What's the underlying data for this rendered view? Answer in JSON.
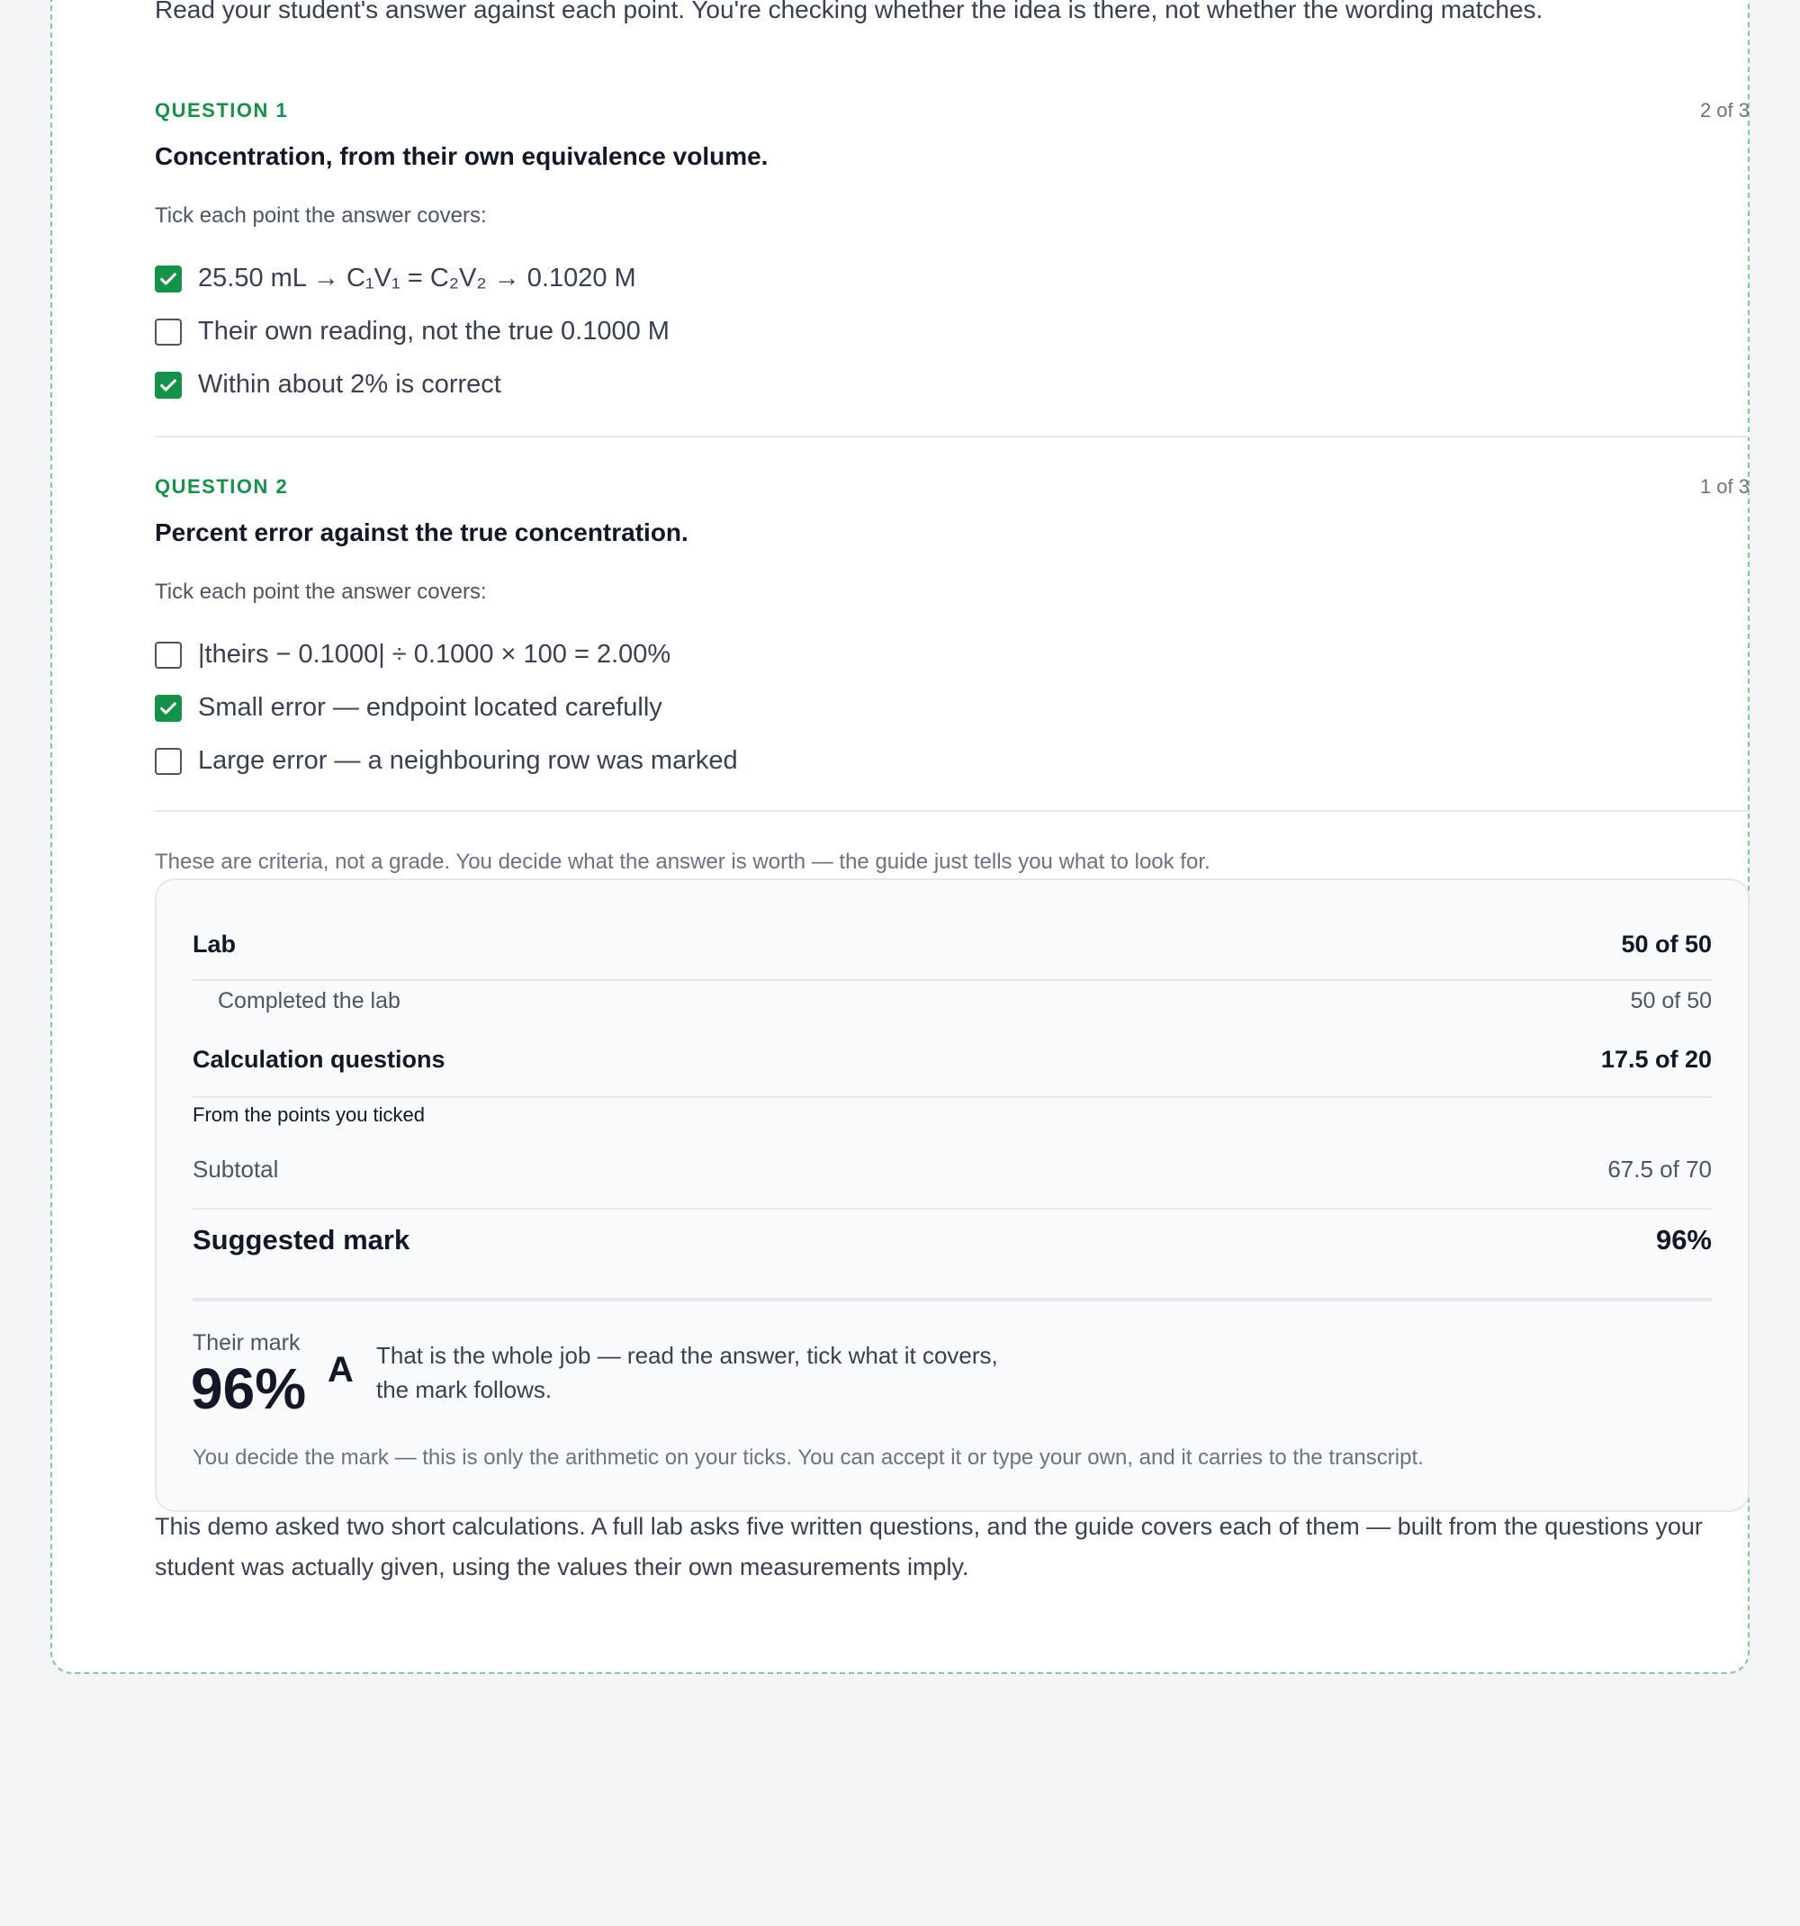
{
  "intro": "Read your student's answer against each point. You're checking whether the idea is there, not whether the wording matches.",
  "questions": [
    {
      "label": "QUESTION 1",
      "count": "2 of 3",
      "title": "Concentration, from their own equivalence volume.",
      "subtitle": "Tick each point the answer covers:",
      "criteria": [
        {
          "text": "25.50 mL → C₁V₁ = C₂V₂ → 0.1020 M",
          "checked": true
        },
        {
          "text": "Their own reading, not the true 0.1000 M",
          "checked": false
        },
        {
          "text": "Within about 2% is correct",
          "checked": true
        }
      ]
    },
    {
      "label": "QUESTION 2",
      "count": "1 of 3",
      "title": "Percent error against the true concentration.",
      "subtitle": "Tick each point the answer covers:",
      "criteria": [
        {
          "text": "|theirs − 0.1000| ÷ 0.1000 × 100 = 2.00%",
          "checked": false
        },
        {
          "text": "Small error — endpoint located carefully",
          "checked": true
        },
        {
          "text": "Large error — a neighbouring row was marked",
          "checked": false
        }
      ]
    }
  ],
  "criteria_note": "These are criteria, not a grade. You decide what the answer is worth — the guide just tells you what to look for.",
  "summary": {
    "lab_label": "Lab",
    "lab_value": "50 of 50",
    "lab_detail_label": "Completed the lab",
    "lab_detail_value": "50 of 50",
    "calc_label": "Calculation questions",
    "calc_value": "17.5 of 20",
    "calc_detail_label": "From the points you ticked",
    "subtotal_label": "Subtotal",
    "subtotal_value": "67.5 of 70",
    "suggested_label": "Suggested mark",
    "suggested_value": "96%",
    "their_mark_label": "Their mark",
    "their_mark_value": "96%",
    "grade": "A",
    "their_mark_note": "That is the whole job — read the answer, tick what it covers, the mark follows.",
    "footnote": "You decide the mark — this is only the arithmetic on your ticks. You can accept it or type your own, and it carries to the transcript."
  },
  "outro": "This demo asked two short calculations. A full lab asks five written questions, and the guide covers each of them — built from the questions your student was actually given, using the values their own measurements imply.",
  "colors": {
    "accent": "#15924a",
    "border_dashed": "#7ccd9a",
    "background": "#f3f4f6"
  }
}
